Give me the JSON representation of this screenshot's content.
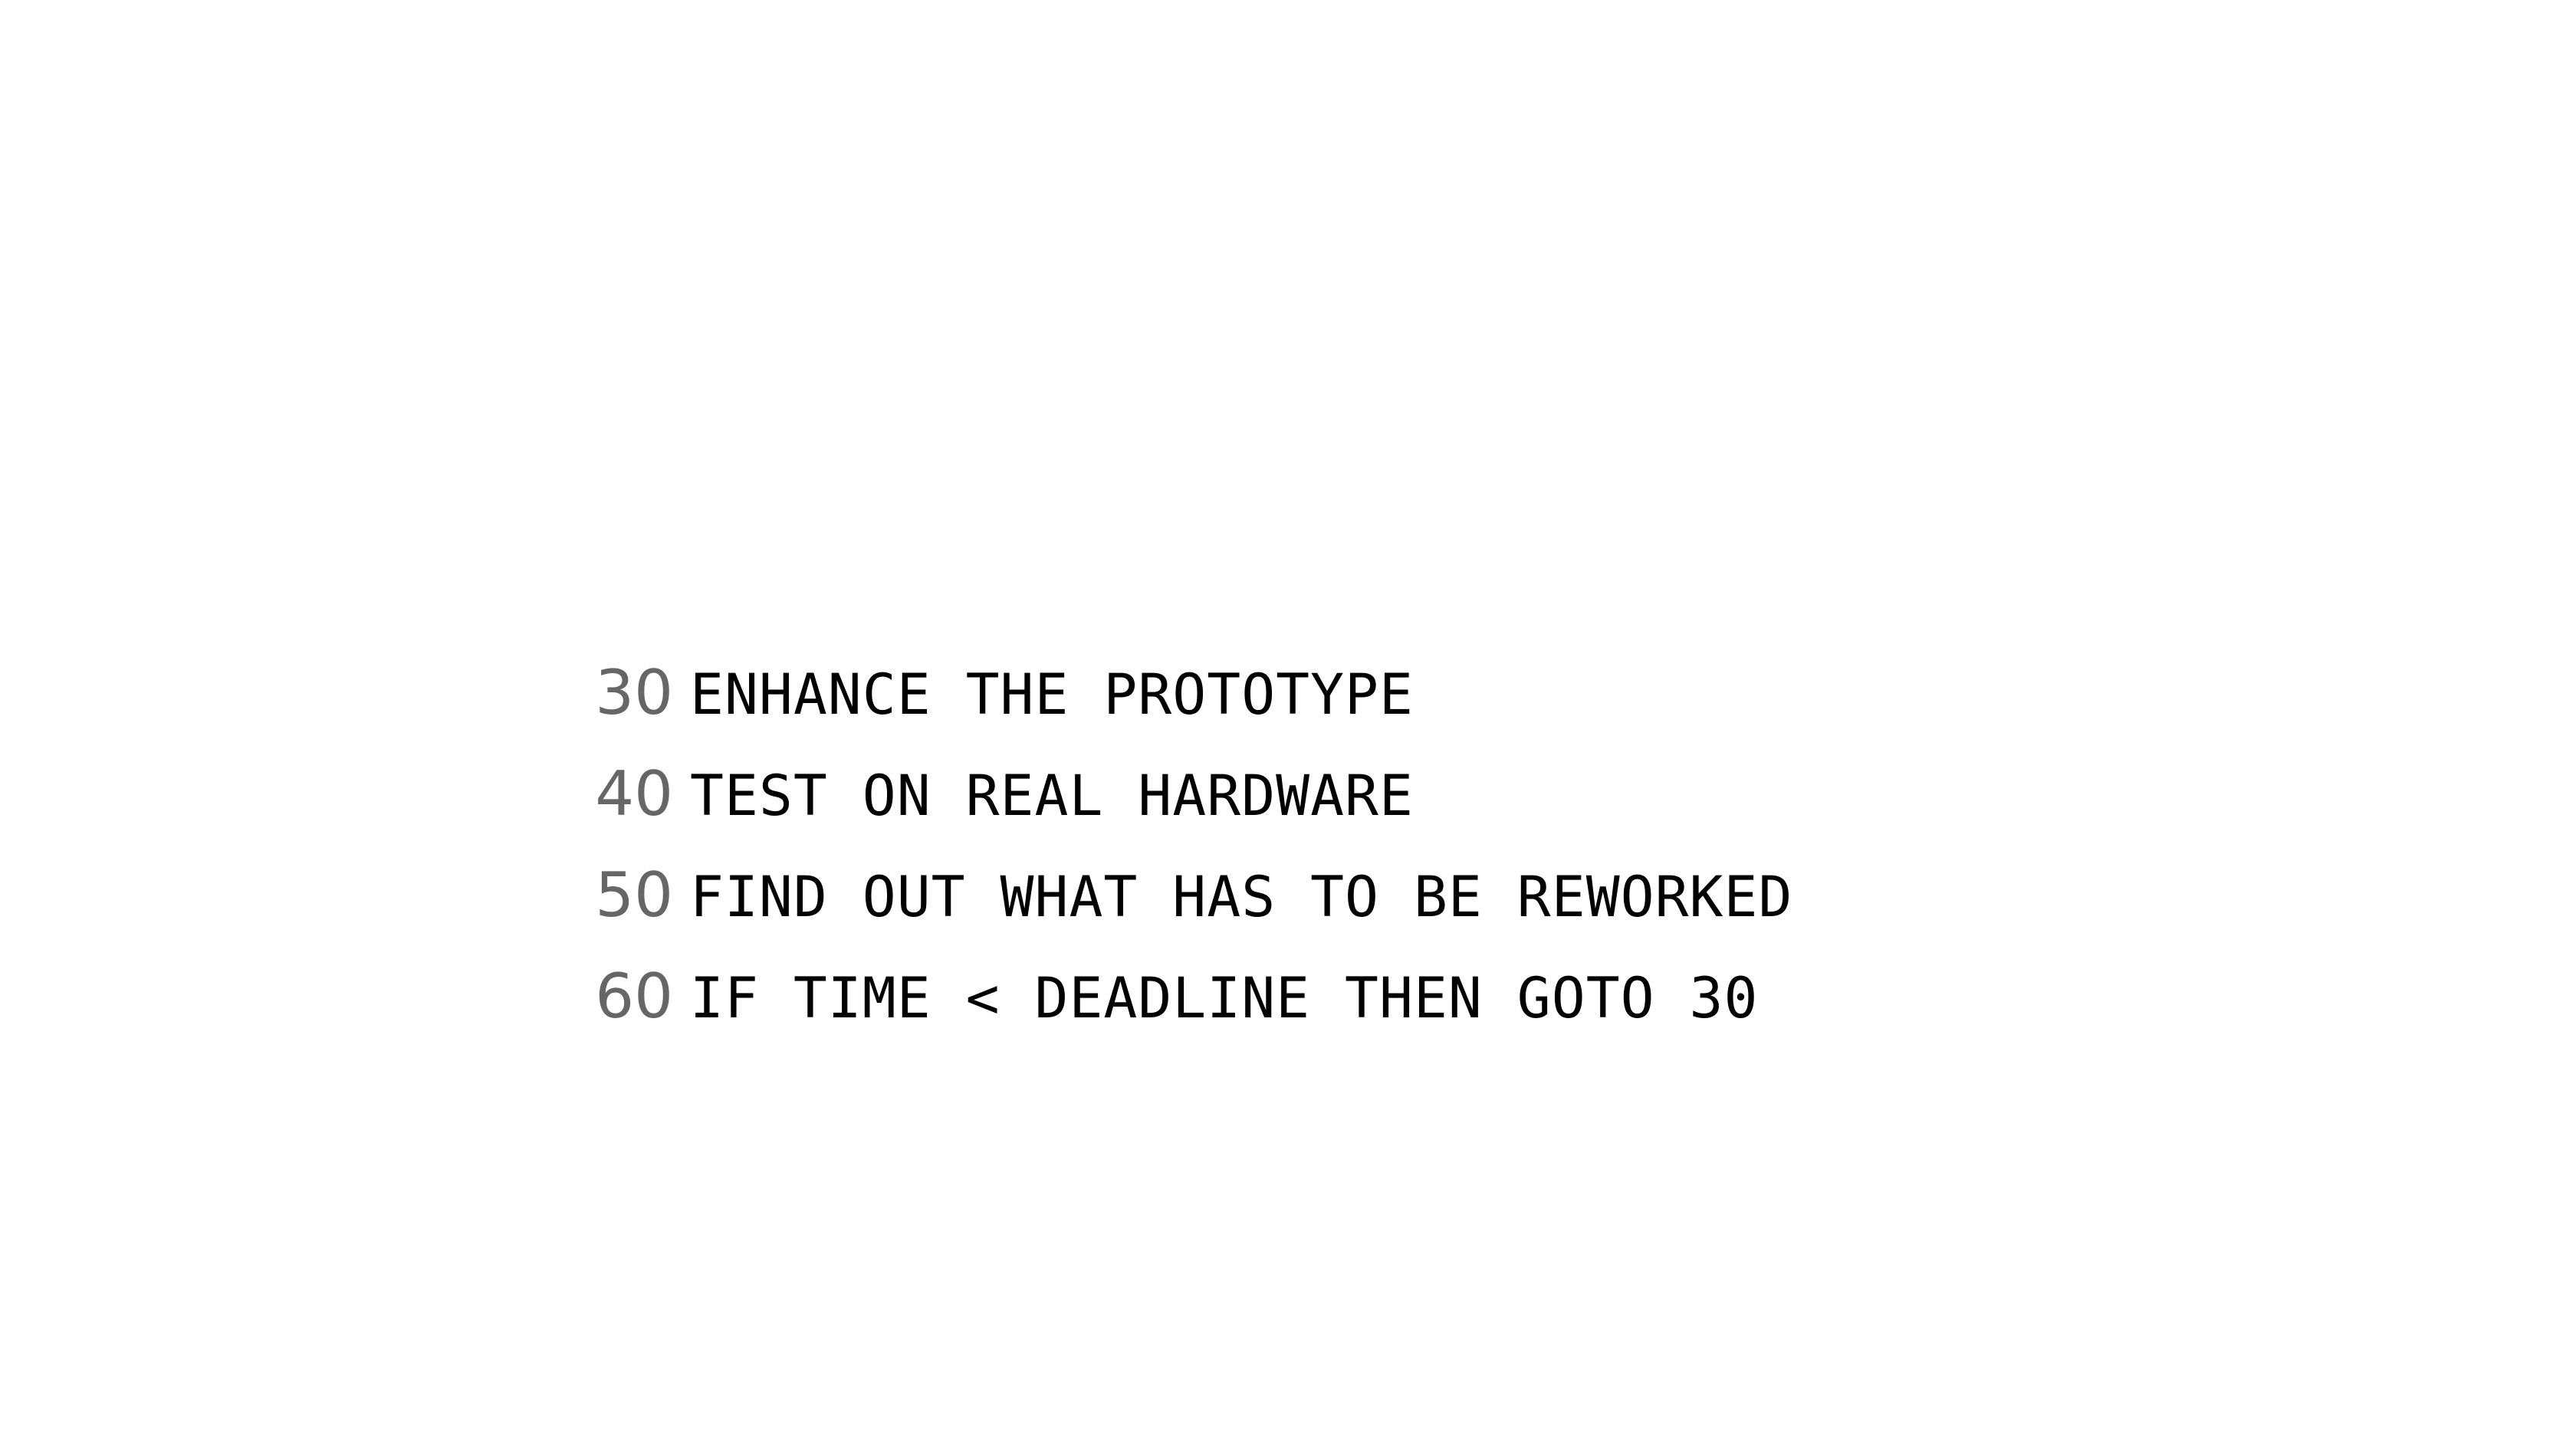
{
  "code": {
    "lines": [
      {
        "number": "30",
        "text": "ENHANCE THE PROTOTYPE"
      },
      {
        "number": "40",
        "text": "TEST ON REAL HARDWARE"
      },
      {
        "number": "50",
        "text": "FIND OUT WHAT HAS TO BE REWORKED"
      },
      {
        "number": "60",
        "text": "IF TIME < DEADLINE THEN GOTO 30"
      }
    ]
  },
  "colors": {
    "background": "#ffffff",
    "line_number": "#666666",
    "code_text": "#000000"
  }
}
